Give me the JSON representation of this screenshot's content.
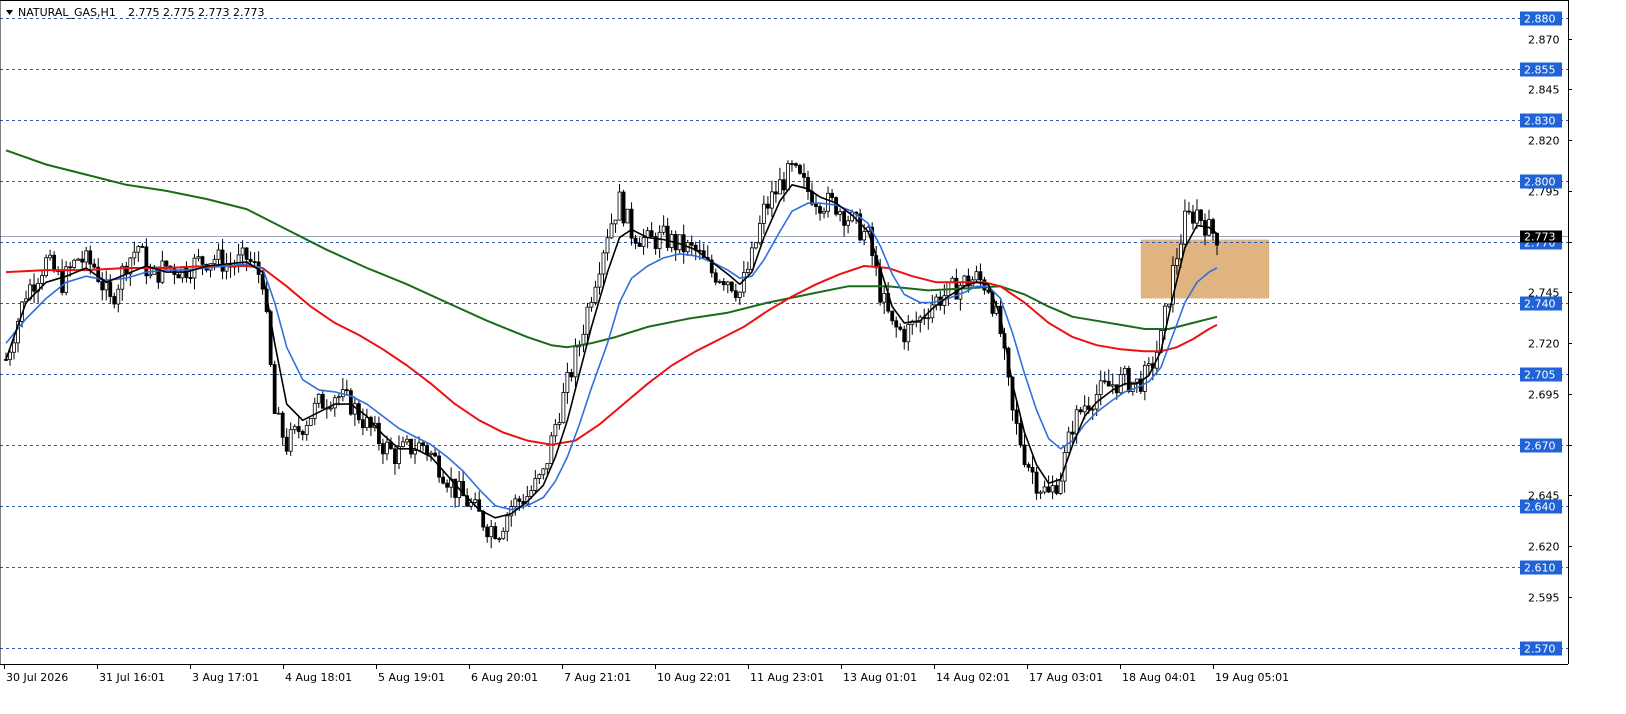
{
  "header": {
    "symbol_timeframe": "NATURAL_GAS,H1",
    "ohlc": "2.775 2.775 2.773 2.773"
  },
  "colors": {
    "background": "#ffffff",
    "candle": "#000000",
    "ma_fast": "#000000",
    "ma_blue": "#2f6fe0",
    "ma_red": "#ee1111",
    "ma_green": "#1a6b1a",
    "level_line": "#2a5db0",
    "level_label_bg": "#1f63d6",
    "current_price_line": "#9aa8b8",
    "zone_fill": "#d9a76a"
  },
  "chart_data": {
    "type": "candlestick",
    "title": "NATURAL_GAS,H1",
    "xlabel": "",
    "ylabel": "",
    "ylim": [
      2.562,
      2.889
    ],
    "grid": false,
    "price_ticks": [
      "2.870",
      "2.845",
      "2.820",
      "2.795",
      "2.770",
      "2.745",
      "2.720",
      "2.695",
      "2.670",
      "2.645",
      "2.620",
      "2.595"
    ],
    "level_labels": [
      "2.880",
      "2.855",
      "2.830",
      "2.800",
      "2.770",
      "2.740",
      "2.705",
      "2.670",
      "2.640",
      "2.610",
      "2.570"
    ],
    "current_price": "2.773",
    "time_labels": [
      "30 Jul 2026",
      "31 Jul 16:01",
      "3 Aug 17:01",
      "4 Aug 18:01",
      "5 Aug 19:01",
      "6 Aug 20:01",
      "7 Aug 21:01",
      "10 Aug 22:01",
      "11 Aug 23:01",
      "13 Aug 01:01",
      "14 Aug 02:01",
      "17 Aug 03:01",
      "18 Aug 04:01",
      "19 Aug 05:01"
    ],
    "price_path": [
      [
        0,
        2.712
      ],
      [
        5,
        2.745
      ],
      [
        10,
        2.76
      ],
      [
        14,
        2.75
      ],
      [
        18,
        2.762
      ],
      [
        22,
        2.758
      ],
      [
        26,
        2.74
      ],
      [
        30,
        2.76
      ],
      [
        33,
        2.768
      ],
      [
        36,
        2.752
      ],
      [
        40,
        2.758
      ],
      [
        44,
        2.756
      ],
      [
        48,
        2.76
      ],
      [
        52,
        2.762
      ],
      [
        56,
        2.758
      ],
      [
        60,
        2.762
      ],
      [
        64,
        2.752
      ],
      [
        67,
        2.685
      ],
      [
        70,
        2.67
      ],
      [
        74,
        2.68
      ],
      [
        78,
        2.69
      ],
      [
        82,
        2.695
      ],
      [
        86,
        2.69
      ],
      [
        90,
        2.68
      ],
      [
        94,
        2.67
      ],
      [
        97,
        2.665
      ],
      [
        100,
        2.668
      ],
      [
        104,
        2.67
      ],
      [
        108,
        2.66
      ],
      [
        112,
        2.648
      ],
      [
        116,
        2.64
      ],
      [
        120,
        2.63
      ],
      [
        123,
        2.628
      ],
      [
        126,
        2.64
      ],
      [
        130,
        2.645
      ],
      [
        134,
        2.655
      ],
      [
        137,
        2.68
      ],
      [
        140,
        2.7
      ],
      [
        143,
        2.72
      ],
      [
        146,
        2.745
      ],
      [
        150,
        2.775
      ],
      [
        153,
        2.79
      ],
      [
        156,
        2.775
      ],
      [
        160,
        2.77
      ],
      [
        164,
        2.772
      ],
      [
        168,
        2.768
      ],
      [
        172,
        2.765
      ],
      [
        176,
        2.755
      ],
      [
        180,
        2.752
      ],
      [
        183,
        2.745
      ],
      [
        186,
        2.762
      ],
      [
        189,
        2.785
      ],
      [
        193,
        2.798
      ],
      [
        196,
        2.805
      ],
      [
        200,
        2.795
      ],
      [
        203,
        2.79
      ],
      [
        207,
        2.788
      ],
      [
        211,
        2.78
      ],
      [
        215,
        2.772
      ],
      [
        218,
        2.745
      ],
      [
        221,
        2.728
      ],
      [
        224,
        2.725
      ],
      [
        228,
        2.732
      ],
      [
        231,
        2.74
      ],
      [
        235,
        2.745
      ],
      [
        239,
        2.75
      ],
      [
        242,
        2.752
      ],
      [
        245,
        2.748
      ],
      [
        248,
        2.725
      ],
      [
        251,
        2.685
      ],
      [
        254,
        2.665
      ],
      [
        257,
        2.652
      ],
      [
        260,
        2.645
      ],
      [
        263,
        2.655
      ],
      [
        266,
        2.68
      ],
      [
        269,
        2.69
      ],
      [
        272,
        2.695
      ],
      [
        276,
        2.7
      ],
      [
        279,
        2.702
      ],
      [
        282,
        2.7
      ],
      [
        285,
        2.705
      ],
      [
        288,
        2.722
      ],
      [
        291,
        2.755
      ],
      [
        294,
        2.78
      ],
      [
        297,
        2.785
      ],
      [
        300,
        2.776
      ],
      [
        302,
        2.773
      ]
    ],
    "ma_fast": [
      [
        0,
        2.712
      ],
      [
        5,
        2.74
      ],
      [
        10,
        2.75
      ],
      [
        15,
        2.753
      ],
      [
        20,
        2.757
      ],
      [
        25,
        2.75
      ],
      [
        30,
        2.754
      ],
      [
        35,
        2.758
      ],
      [
        40,
        2.755
      ],
      [
        45,
        2.755
      ],
      [
        50,
        2.758
      ],
      [
        55,
        2.759
      ],
      [
        60,
        2.76
      ],
      [
        64,
        2.755
      ],
      [
        67,
        2.72
      ],
      [
        70,
        2.69
      ],
      [
        74,
        2.682
      ],
      [
        78,
        2.686
      ],
      [
        82,
        2.69
      ],
      [
        86,
        2.69
      ],
      [
        90,
        2.684
      ],
      [
        94,
        2.675
      ],
      [
        98,
        2.668
      ],
      [
        102,
        2.668
      ],
      [
        106,
        2.664
      ],
      [
        110,
        2.655
      ],
      [
        114,
        2.646
      ],
      [
        118,
        2.638
      ],
      [
        122,
        2.634
      ],
      [
        126,
        2.636
      ],
      [
        130,
        2.642
      ],
      [
        134,
        2.65
      ],
      [
        137,
        2.664
      ],
      [
        140,
        2.682
      ],
      [
        143,
        2.705
      ],
      [
        146,
        2.728
      ],
      [
        150,
        2.755
      ],
      [
        153,
        2.772
      ],
      [
        156,
        2.776
      ],
      [
        160,
        2.772
      ],
      [
        164,
        2.771
      ],
      [
        168,
        2.769
      ],
      [
        172,
        2.766
      ],
      [
        176,
        2.76
      ],
      [
        180,
        2.754
      ],
      [
        183,
        2.749
      ],
      [
        186,
        2.755
      ],
      [
        189,
        2.772
      ],
      [
        193,
        2.79
      ],
      [
        196,
        2.798
      ],
      [
        200,
        2.796
      ],
      [
        203,
        2.792
      ],
      [
        207,
        2.789
      ],
      [
        211,
        2.783
      ],
      [
        215,
        2.775
      ],
      [
        218,
        2.757
      ],
      [
        221,
        2.738
      ],
      [
        224,
        2.73
      ],
      [
        228,
        2.731
      ],
      [
        231,
        2.737
      ],
      [
        235,
        2.743
      ],
      [
        239,
        2.748
      ],
      [
        242,
        2.75
      ],
      [
        245,
        2.749
      ],
      [
        248,
        2.733
      ],
      [
        251,
        2.7
      ],
      [
        254,
        2.676
      ],
      [
        257,
        2.66
      ],
      [
        260,
        2.651
      ],
      [
        263,
        2.653
      ],
      [
        266,
        2.67
      ],
      [
        269,
        2.684
      ],
      [
        272,
        2.691
      ],
      [
        276,
        2.697
      ],
      [
        279,
        2.7
      ],
      [
        282,
        2.7
      ],
      [
        285,
        2.704
      ],
      [
        288,
        2.716
      ],
      [
        291,
        2.743
      ],
      [
        294,
        2.767
      ],
      [
        297,
        2.778
      ],
      [
        300,
        2.777
      ],
      [
        302,
        2.774
      ]
    ],
    "ma_blue": [
      [
        0,
        2.72
      ],
      [
        5,
        2.732
      ],
      [
        10,
        2.742
      ],
      [
        15,
        2.75
      ],
      [
        20,
        2.753
      ],
      [
        25,
        2.751
      ],
      [
        30,
        2.752
      ],
      [
        35,
        2.755
      ],
      [
        40,
        2.756
      ],
      [
        45,
        2.756
      ],
      [
        50,
        2.757
      ],
      [
        55,
        2.758
      ],
      [
        60,
        2.759
      ],
      [
        64,
        2.757
      ],
      [
        67,
        2.74
      ],
      [
        70,
        2.718
      ],
      [
        74,
        2.702
      ],
      [
        78,
        2.697
      ],
      [
        82,
        2.696
      ],
      [
        86,
        2.694
      ],
      [
        90,
        2.69
      ],
      [
        94,
        2.684
      ],
      [
        98,
        2.678
      ],
      [
        102,
        2.674
      ],
      [
        106,
        2.67
      ],
      [
        110,
        2.664
      ],
      [
        114,
        2.657
      ],
      [
        118,
        2.648
      ],
      [
        122,
        2.64
      ],
      [
        126,
        2.638
      ],
      [
        130,
        2.64
      ],
      [
        134,
        2.644
      ],
      [
        137,
        2.652
      ],
      [
        140,
        2.664
      ],
      [
        143,
        2.68
      ],
      [
        146,
        2.698
      ],
      [
        150,
        2.72
      ],
      [
        153,
        2.74
      ],
      [
        156,
        2.752
      ],
      [
        160,
        2.758
      ],
      [
        164,
        2.762
      ],
      [
        168,
        2.764
      ],
      [
        172,
        2.763
      ],
      [
        176,
        2.76
      ],
      [
        180,
        2.756
      ],
      [
        183,
        2.752
      ],
      [
        186,
        2.753
      ],
      [
        189,
        2.761
      ],
      [
        193,
        2.775
      ],
      [
        196,
        2.785
      ],
      [
        200,
        2.789
      ],
      [
        203,
        2.789
      ],
      [
        207,
        2.788
      ],
      [
        211,
        2.785
      ],
      [
        215,
        2.779
      ],
      [
        218,
        2.768
      ],
      [
        221,
        2.754
      ],
      [
        224,
        2.744
      ],
      [
        228,
        2.74
      ],
      [
        231,
        2.74
      ],
      [
        235,
        2.742
      ],
      [
        239,
        2.745
      ],
      [
        242,
        2.748
      ],
      [
        245,
        2.748
      ],
      [
        248,
        2.742
      ],
      [
        251,
        2.725
      ],
      [
        254,
        2.705
      ],
      [
        257,
        2.687
      ],
      [
        260,
        2.673
      ],
      [
        263,
        2.668
      ],
      [
        266,
        2.672
      ],
      [
        269,
        2.68
      ],
      [
        272,
        2.686
      ],
      [
        276,
        2.692
      ],
      [
        279,
        2.696
      ],
      [
        282,
        2.698
      ],
      [
        285,
        2.701
      ],
      [
        288,
        2.708
      ],
      [
        291,
        2.724
      ],
      [
        294,
        2.74
      ],
      [
        297,
        2.75
      ],
      [
        300,
        2.755
      ],
      [
        302,
        2.757
      ]
    ],
    "ma_red": [
      [
        0,
        2.755
      ],
      [
        10,
        2.756
      ],
      [
        20,
        2.756
      ],
      [
        30,
        2.757
      ],
      [
        40,
        2.757
      ],
      [
        50,
        2.758
      ],
      [
        60,
        2.758
      ],
      [
        64,
        2.757
      ],
      [
        70,
        2.748
      ],
      [
        76,
        2.738
      ],
      [
        82,
        2.73
      ],
      [
        88,
        2.724
      ],
      [
        94,
        2.717
      ],
      [
        100,
        2.709
      ],
      [
        106,
        2.7
      ],
      [
        112,
        2.69
      ],
      [
        118,
        2.682
      ],
      [
        124,
        2.676
      ],
      [
        130,
        2.672
      ],
      [
        136,
        2.67
      ],
      [
        142,
        2.672
      ],
      [
        148,
        2.68
      ],
      [
        154,
        2.69
      ],
      [
        160,
        2.7
      ],
      [
        166,
        2.709
      ],
      [
        172,
        2.716
      ],
      [
        178,
        2.722
      ],
      [
        184,
        2.728
      ],
      [
        190,
        2.736
      ],
      [
        196,
        2.743
      ],
      [
        202,
        2.749
      ],
      [
        208,
        2.754
      ],
      [
        214,
        2.758
      ],
      [
        220,
        2.757
      ],
      [
        226,
        2.753
      ],
      [
        232,
        2.75
      ],
      [
        238,
        2.75
      ],
      [
        244,
        2.75
      ],
      [
        248,
        2.748
      ],
      [
        254,
        2.74
      ],
      [
        260,
        2.73
      ],
      [
        266,
        2.723
      ],
      [
        272,
        2.719
      ],
      [
        278,
        2.717
      ],
      [
        284,
        2.716
      ],
      [
        288,
        2.716
      ],
      [
        292,
        2.718
      ],
      [
        296,
        2.722
      ],
      [
        300,
        2.727
      ],
      [
        302,
        2.729
      ]
    ],
    "ma_green": [
      [
        0,
        2.815
      ],
      [
        10,
        2.808
      ],
      [
        20,
        2.803
      ],
      [
        30,
        2.798
      ],
      [
        40,
        2.795
      ],
      [
        50,
        2.791
      ],
      [
        60,
        2.786
      ],
      [
        70,
        2.776
      ],
      [
        80,
        2.766
      ],
      [
        90,
        2.757
      ],
      [
        100,
        2.749
      ],
      [
        110,
        2.74
      ],
      [
        120,
        2.731
      ],
      [
        130,
        2.723
      ],
      [
        136,
        2.719
      ],
      [
        140,
        2.718
      ],
      [
        146,
        2.72
      ],
      [
        152,
        2.723
      ],
      [
        160,
        2.728
      ],
      [
        170,
        2.732
      ],
      [
        180,
        2.735
      ],
      [
        190,
        2.74
      ],
      [
        200,
        2.744
      ],
      [
        210,
        2.748
      ],
      [
        220,
        2.748
      ],
      [
        230,
        2.746
      ],
      [
        240,
        2.747
      ],
      [
        248,
        2.748
      ],
      [
        254,
        2.744
      ],
      [
        260,
        2.738
      ],
      [
        266,
        2.733
      ],
      [
        272,
        2.731
      ],
      [
        278,
        2.729
      ],
      [
        284,
        2.727
      ],
      [
        290,
        2.727
      ],
      [
        296,
        2.73
      ],
      [
        302,
        2.733
      ]
    ],
    "zone": {
      "price_top": 2.771,
      "price_bottom": 2.742,
      "start_index": 283,
      "end_index": 315
    },
    "total_bars": 390
  }
}
